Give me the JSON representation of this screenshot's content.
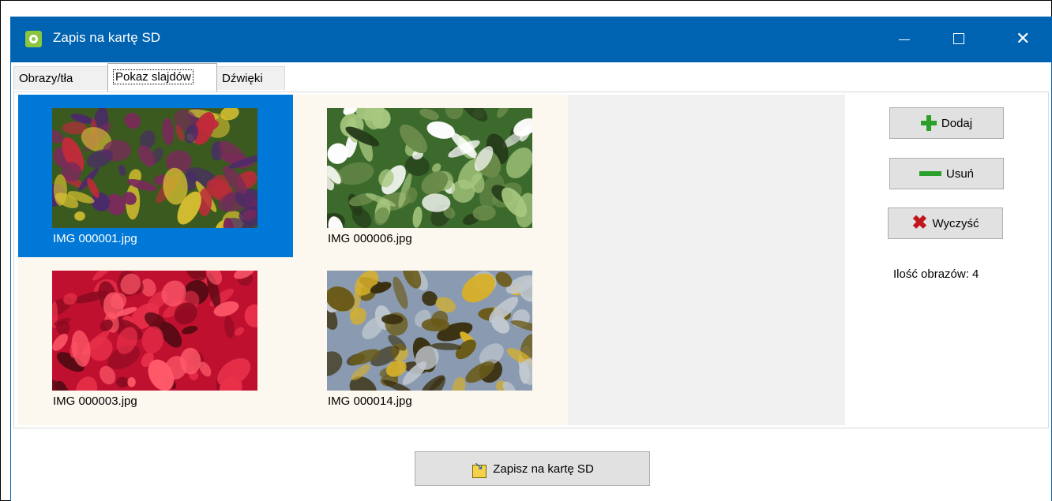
{
  "window": {
    "title": "Zapis na kartę SD",
    "title_bar_color": "#0063b1",
    "controls": {
      "minimize_icon": "minimize-icon",
      "maximize_icon": "maximize-icon",
      "close_icon": "close-icon",
      "close_glyph": "✕"
    }
  },
  "tabs": [
    {
      "label": "Obrazy/tła",
      "active": false
    },
    {
      "label": "Pokaz slajdów",
      "active": true
    },
    {
      "label": "Dźwięki",
      "active": false
    }
  ],
  "gallery": {
    "items": [
      {
        "filename": "IMG 000001.jpg",
        "selected": true,
        "palette": [
          "#3a5a20",
          "#7a2a5a",
          "#c02a3a",
          "#d8c030",
          "#4a2a6a"
        ]
      },
      {
        "filename": "IMG 000006.jpg",
        "selected": false,
        "palette": [
          "#3c6a2c",
          "#ffffff",
          "#6a8a4a",
          "#243a18",
          "#a8c880"
        ]
      },
      {
        "filename": "IMG 000003.jpg",
        "selected": false,
        "palette": [
          "#c01030",
          "#e8304a",
          "#8a0a20",
          "#ff5a6a",
          "#5a0a14"
        ]
      },
      {
        "filename": "IMG 000014.jpg",
        "selected": false,
        "palette": [
          "#8a9ab0",
          "#d8b028",
          "#6a5a18",
          "#c0c8d0",
          "#3a3010"
        ]
      }
    ],
    "selected_color": "#0078d7"
  },
  "side_panel": {
    "add_label": "Dodaj",
    "remove_label": "Usuń",
    "clear_label": "Wyczyść",
    "count_text": "Ilość obrazów: 4",
    "icons": {
      "add": "plus-icon",
      "remove": "minus-icon",
      "clear": "x-icon"
    },
    "clear_glyph": "✖"
  },
  "footer": {
    "save_label": "Zapisz na kartę SD",
    "save_icon": "sd-card-icon",
    "arrow_glyph": "↘"
  }
}
